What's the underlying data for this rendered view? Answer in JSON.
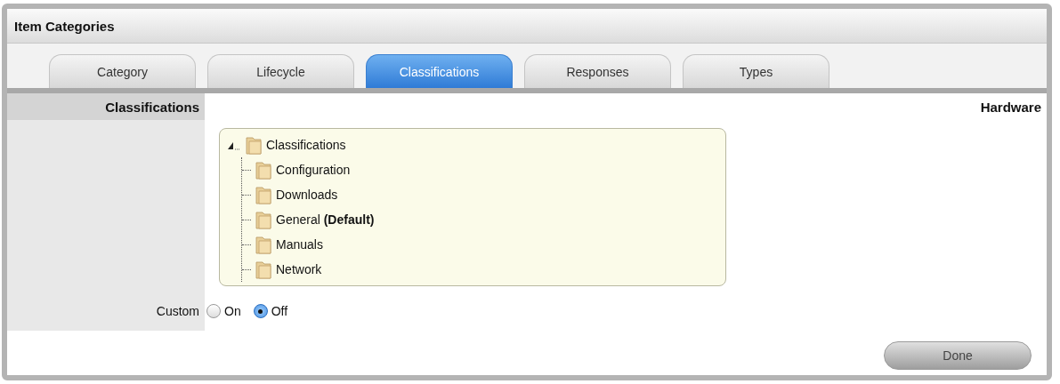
{
  "window": {
    "title": "Item Categories"
  },
  "tabs": [
    {
      "label": "Category",
      "selected": false
    },
    {
      "label": "Lifecycle",
      "selected": false
    },
    {
      "label": "Classifications",
      "selected": true
    },
    {
      "label": "Responses",
      "selected": false
    },
    {
      "label": "Types",
      "selected": false
    }
  ],
  "section": {
    "label": "Classifications",
    "value": "Hardware"
  },
  "tree": {
    "label": "Classifications",
    "expanded": true,
    "children": [
      {
        "label": "Configuration"
      },
      {
        "label": "Downloads"
      },
      {
        "label": "General **(Default)**"
      },
      {
        "label": "Manuals"
      },
      {
        "label": "Network"
      }
    ]
  },
  "custom": {
    "label": "Custom",
    "options": [
      {
        "label": "On",
        "selected": false
      },
      {
        "label": "Off",
        "selected": true
      }
    ]
  },
  "buttons": [
    "Done"
  ]
}
